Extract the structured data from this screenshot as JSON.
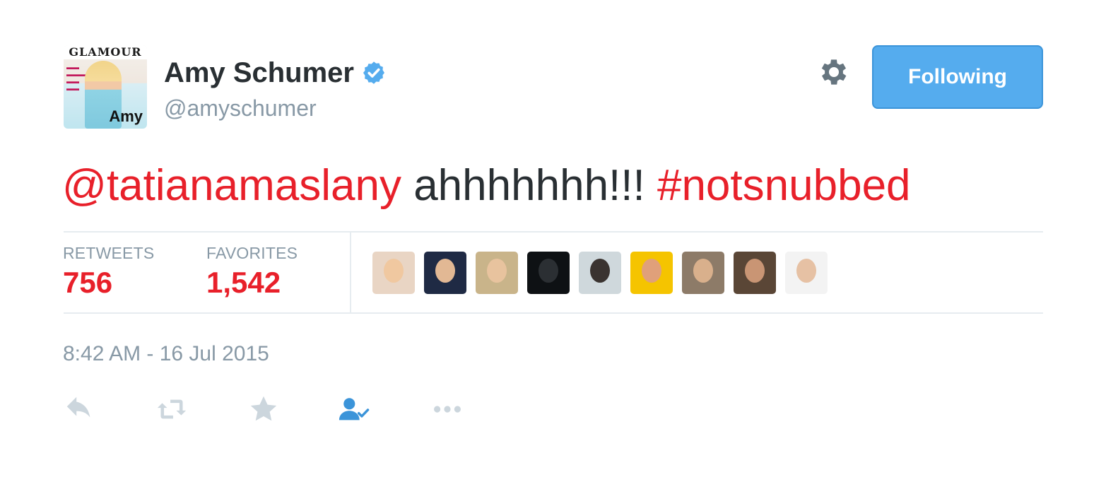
{
  "author": {
    "display_name": "Amy Schumer",
    "handle": "@amyschumer",
    "verified": true,
    "avatar_masthead": "GLAMOUR",
    "avatar_name": "Amy"
  },
  "follow_button": {
    "label": "Following"
  },
  "tweet": {
    "mention": "@tatianamaslany",
    "body": "ahhhhhhh!!!",
    "hashtag": "#notsnubbed"
  },
  "stats": {
    "retweets_label": "RETWEETS",
    "retweets_value": "756",
    "favorites_label": "FAVORITES",
    "favorites_value": "1,542"
  },
  "favoriters": [
    {
      "icon": "user-avatar-1",
      "bg": "#e9d5c4",
      "skin": "#f0c8a0"
    },
    {
      "icon": "user-avatar-2",
      "bg": "#1f2a44",
      "skin": "#e2b894"
    },
    {
      "icon": "user-avatar-3",
      "bg": "#c9b48a",
      "skin": "#e8c39e"
    },
    {
      "icon": "user-avatar-4",
      "bg": "#0e1114",
      "skin": "#2b2f33"
    },
    {
      "icon": "user-avatar-5",
      "bg": "#cfd8dc",
      "skin": "#3a3330"
    },
    {
      "icon": "user-avatar-6",
      "bg": "#f5c400",
      "skin": "#e0a07a"
    },
    {
      "icon": "user-avatar-7",
      "bg": "#8d7b68",
      "skin": "#d9b08c"
    },
    {
      "icon": "user-avatar-8",
      "bg": "#5a4636",
      "skin": "#c99574"
    },
    {
      "icon": "user-avatar-9",
      "bg": "#f3f3f3",
      "skin": "#e6c1a4"
    }
  ],
  "timestamp": "8:42 AM - 16 Jul 2015",
  "actions": {
    "reply": "reply-icon",
    "retweet": "retweet-icon",
    "favorite": "star-icon",
    "follow": "follow-user-icon",
    "more": "more-icon"
  },
  "colors": {
    "accent_red": "#e8202a",
    "button_blue": "#55acee",
    "muted": "#8899a6",
    "text": "#292f33",
    "active_blue": "#3b94d9"
  }
}
